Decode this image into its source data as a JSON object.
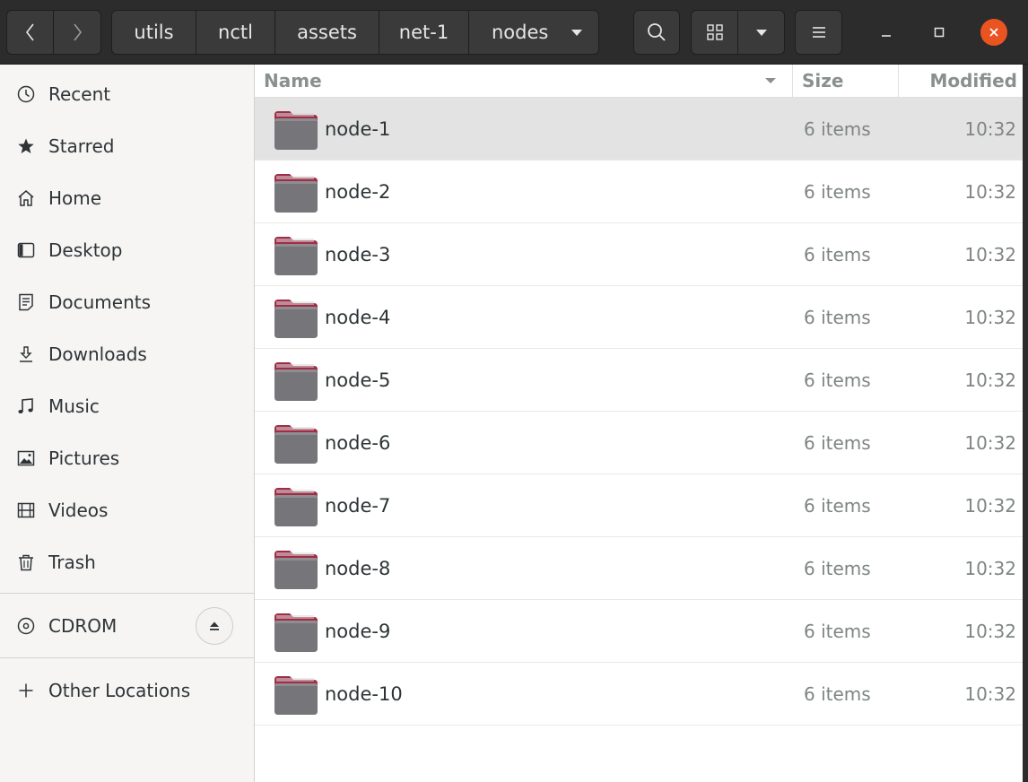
{
  "header": {
    "back_icon": "chevron-left-icon",
    "forward_icon": "chevron-right-icon",
    "breadcrumbs": [
      "utils",
      "nctl",
      "assets",
      "net-1",
      "nodes"
    ],
    "search_icon": "search-icon",
    "view_icon": "grid-icon",
    "menu_icon": "hamburger-icon",
    "window_controls": [
      "minimize",
      "maximize",
      "close"
    ],
    "accent_close": "#e95420"
  },
  "sidebar": {
    "places": [
      {
        "label": "Recent",
        "icon": "clock-icon"
      },
      {
        "label": "Starred",
        "icon": "star-icon"
      },
      {
        "label": "Home",
        "icon": "home-icon"
      },
      {
        "label": "Desktop",
        "icon": "desktop-icon"
      },
      {
        "label": "Documents",
        "icon": "document-icon"
      },
      {
        "label": "Downloads",
        "icon": "download-icon"
      },
      {
        "label": "Music",
        "icon": "music-icon"
      },
      {
        "label": "Pictures",
        "icon": "picture-icon"
      },
      {
        "label": "Videos",
        "icon": "video-icon"
      },
      {
        "label": "Trash",
        "icon": "trash-icon"
      }
    ],
    "devices": [
      {
        "label": "CDROM",
        "icon": "disc-icon"
      }
    ],
    "other": {
      "label": "Other Locations",
      "icon": "plus-icon"
    }
  },
  "list": {
    "columns": {
      "name": "Name",
      "size": "Size",
      "modified": "Modified"
    },
    "selected_index": 0,
    "folder_color": "#76767a",
    "folder_tab_color": "#a02d46",
    "rows": [
      {
        "name": "node-1",
        "size": "6 items",
        "modified": "10:32"
      },
      {
        "name": "node-2",
        "size": "6 items",
        "modified": "10:32"
      },
      {
        "name": "node-3",
        "size": "6 items",
        "modified": "10:32"
      },
      {
        "name": "node-4",
        "size": "6 items",
        "modified": "10:32"
      },
      {
        "name": "node-5",
        "size": "6 items",
        "modified": "10:32"
      },
      {
        "name": "node-6",
        "size": "6 items",
        "modified": "10:32"
      },
      {
        "name": "node-7",
        "size": "6 items",
        "modified": "10:32"
      },
      {
        "name": "node-8",
        "size": "6 items",
        "modified": "10:32"
      },
      {
        "name": "node-9",
        "size": "6 items",
        "modified": "10:32"
      },
      {
        "name": "node-10",
        "size": "6 items",
        "modified": "10:32"
      }
    ]
  }
}
